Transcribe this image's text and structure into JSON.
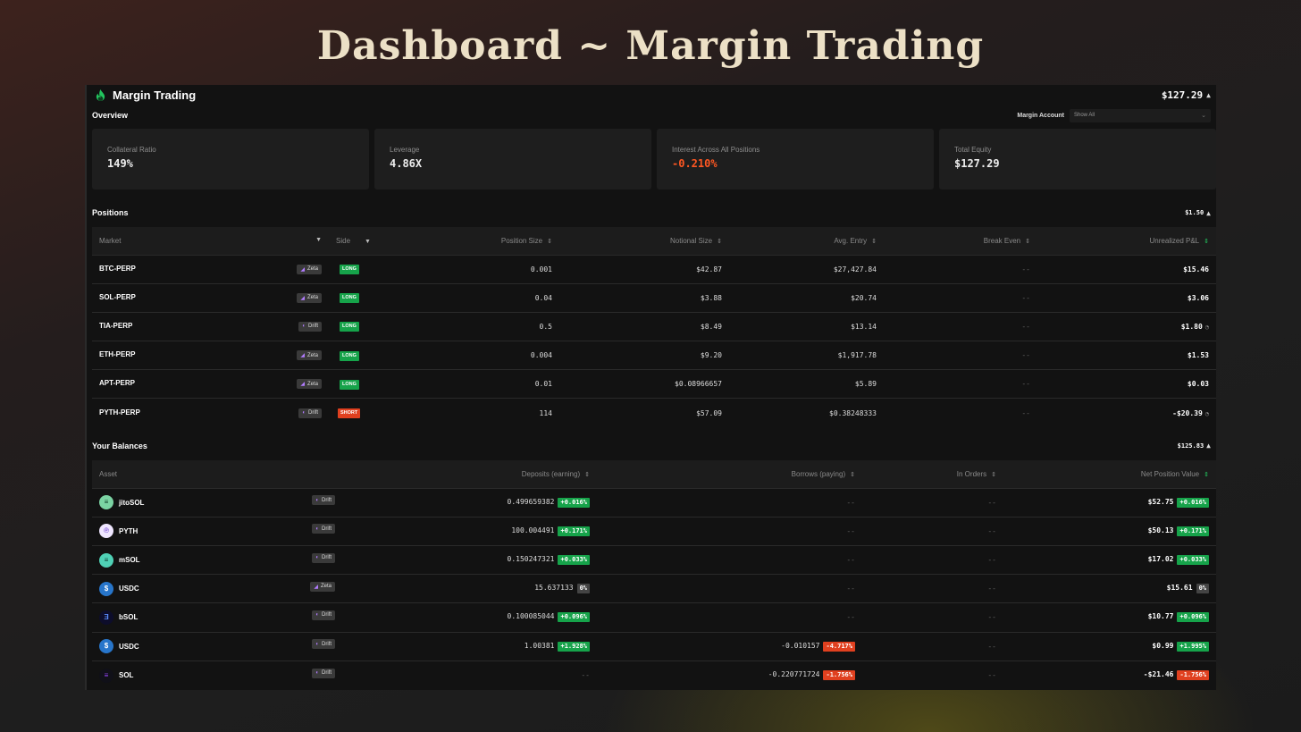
{
  "hero_title": "Dashboard ~ Margin Trading",
  "app": {
    "title": "Margin Trading",
    "total": "$127.29"
  },
  "overview": {
    "title": "Overview",
    "margin_account_label": "Margin Account",
    "margin_account_value": "Show All",
    "cards": [
      {
        "label": "Collateral Ratio",
        "value": "149%"
      },
      {
        "label": "Leverage",
        "value": "4.86X"
      },
      {
        "label": "Interest Across All Positions",
        "value": "-0.210%"
      },
      {
        "label": "Total Equity",
        "value": "$127.29"
      }
    ]
  },
  "positions": {
    "title": "Positions",
    "total": "$1.50",
    "headers": {
      "market": "Market",
      "side": "Side",
      "size": "Position Size",
      "notional": "Notional Size",
      "entry": "Avg. Entry",
      "break_even": "Break Even",
      "pnl": "Unrealized P&L"
    },
    "rows": [
      {
        "market": "BTC-PERP",
        "venue": "Zeta",
        "side": "LONG",
        "size": "0.001",
        "notional": "$42.87",
        "entry": "$27,427.84",
        "break_even": "--",
        "pnl": "$15.46"
      },
      {
        "market": "SOL-PERP",
        "venue": "Zeta",
        "side": "LONG",
        "size": "0.04",
        "notional": "$3.88",
        "entry": "$20.74",
        "break_even": "--",
        "pnl": "$3.06"
      },
      {
        "market": "TIA-PERP",
        "venue": "Drift",
        "side": "LONG",
        "size": "0.5",
        "notional": "$8.49",
        "entry": "$13.14",
        "break_even": "--",
        "pnl": "$1.80"
      },
      {
        "market": "ETH-PERP",
        "venue": "Zeta",
        "side": "LONG",
        "size": "0.004",
        "notional": "$9.20",
        "entry": "$1,917.78",
        "break_even": "--",
        "pnl": "$1.53"
      },
      {
        "market": "APT-PERP",
        "venue": "Zeta",
        "side": "LONG",
        "size": "0.01",
        "notional": "$0.08966657",
        "entry": "$5.89",
        "break_even": "--",
        "pnl": "$0.03"
      },
      {
        "market": "PYTH-PERP",
        "venue": "Drift",
        "side": "SHORT",
        "size": "114",
        "notional": "$57.09",
        "entry": "$0.38248333",
        "break_even": "--",
        "pnl": "-$20.39"
      }
    ]
  },
  "balances": {
    "title": "Your Balances",
    "total": "$125.83",
    "headers": {
      "asset": "Asset",
      "deposits": "Deposits (earning)",
      "borrows": "Borrows (paying)",
      "orders": "In Orders",
      "net": "Net Position Value"
    },
    "rows": [
      {
        "asset": "jitoSOL",
        "venue": "Drift",
        "deposit": "0.499659382",
        "deposit_rate": "+0.016%",
        "borrow": "--",
        "borrow_rate": "",
        "orders": "--",
        "net": "$52.75",
        "net_rate": "+0.016%"
      },
      {
        "asset": "PYTH",
        "venue": "Drift",
        "deposit": "100.004491",
        "deposit_rate": "+0.171%",
        "borrow": "--",
        "borrow_rate": "",
        "orders": "--",
        "net": "$50.13",
        "net_rate": "+0.171%"
      },
      {
        "asset": "mSOL",
        "venue": "Drift",
        "deposit": "0.150247321",
        "deposit_rate": "+0.033%",
        "borrow": "--",
        "borrow_rate": "",
        "orders": "--",
        "net": "$17.02",
        "net_rate": "+0.033%"
      },
      {
        "asset": "USDC",
        "venue": "Zeta",
        "deposit": "15.637133",
        "deposit_rate": "0%",
        "borrow": "--",
        "borrow_rate": "",
        "orders": "--",
        "net": "$15.61",
        "net_rate": "0%"
      },
      {
        "asset": "bSOL",
        "venue": "Drift",
        "deposit": "0.100085044",
        "deposit_rate": "+0.096%",
        "borrow": "--",
        "borrow_rate": "",
        "orders": "--",
        "net": "$10.77",
        "net_rate": "+0.096%"
      },
      {
        "asset": "USDC",
        "venue": "Drift",
        "deposit": "1.00381",
        "deposit_rate": "+1.928%",
        "borrow": "-0.010157",
        "borrow_rate": "-4.717%",
        "orders": "--",
        "net": "$0.99",
        "net_rate": "+1.995%"
      },
      {
        "asset": "SOL",
        "venue": "Drift",
        "deposit": "--",
        "deposit_rate": "",
        "borrow": "-0.220771724",
        "borrow_rate": "-1.756%",
        "orders": "--",
        "net": "-$21.46",
        "net_rate": "-1.756%"
      }
    ]
  },
  "colors": {
    "accent_green": "#16a34a",
    "accent_red": "#e0401f",
    "negative_text": "#ff5722",
    "hero_text": "#ece0c6"
  }
}
